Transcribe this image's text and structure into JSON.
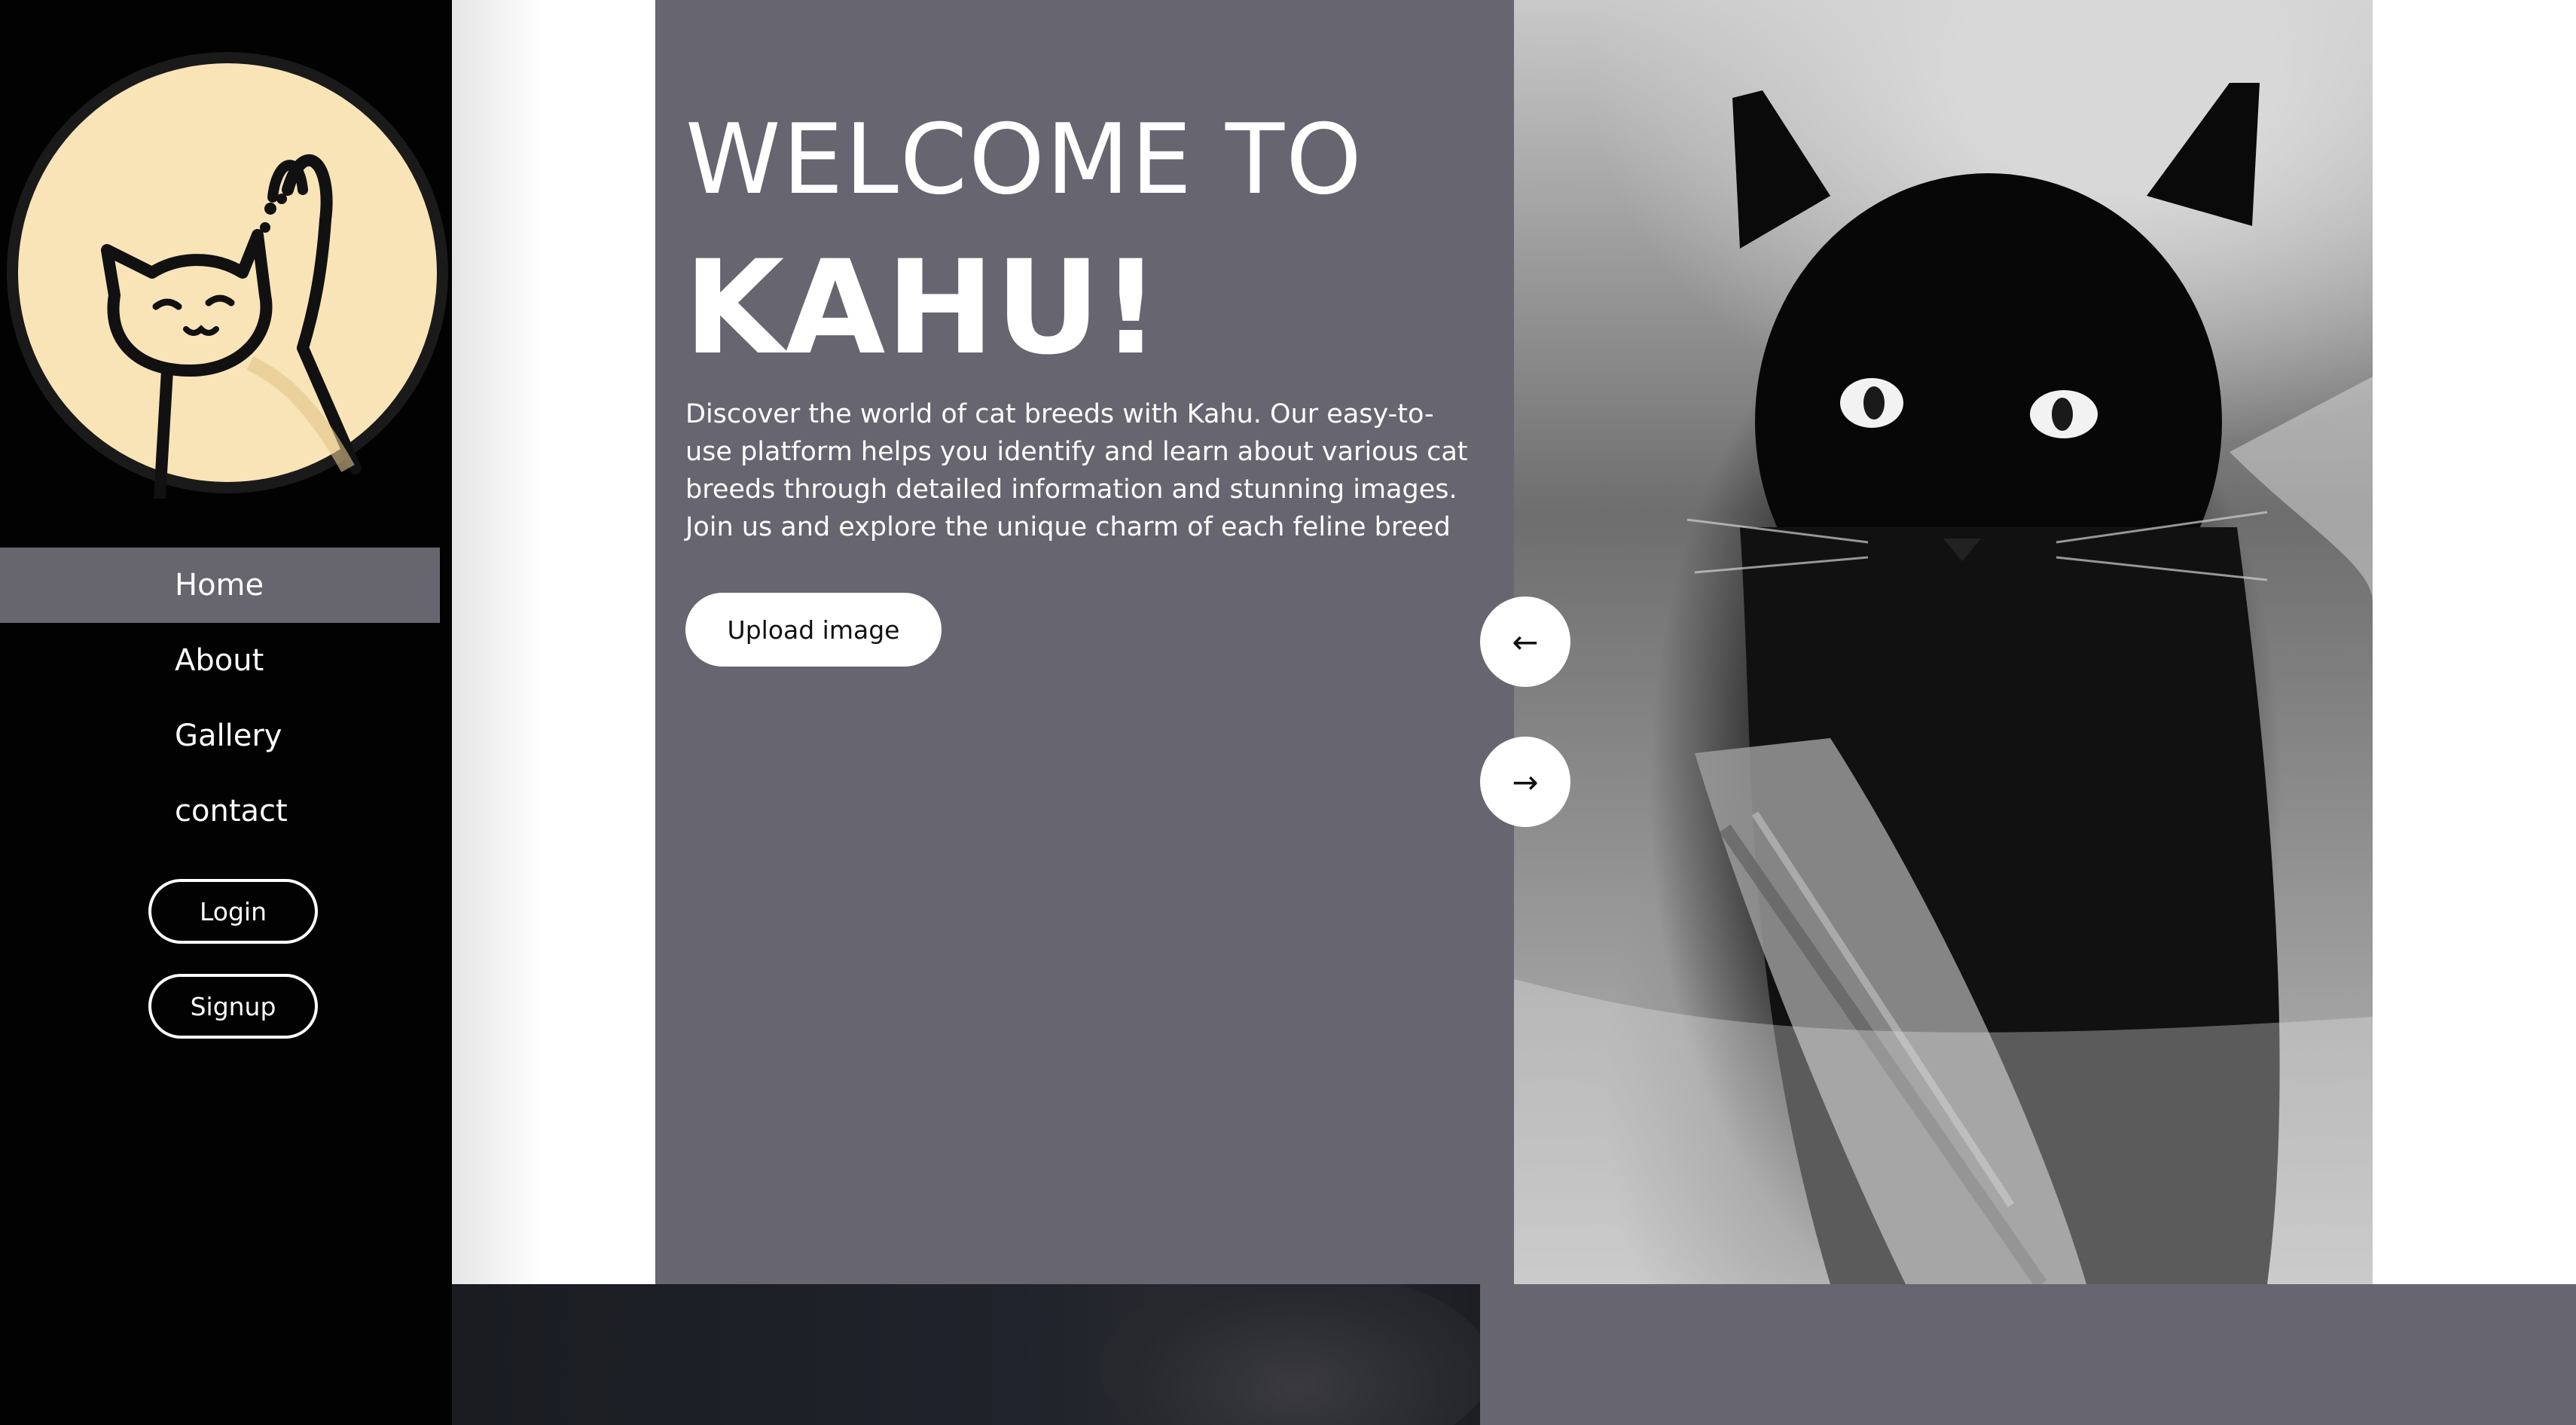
{
  "sidebar": {
    "nav": [
      {
        "label": "Home",
        "active": true
      },
      {
        "label": "About",
        "active": false
      },
      {
        "label": "Gallery",
        "active": false
      },
      {
        "label": "contact",
        "active": false
      }
    ],
    "login_label": "Login",
    "signup_label": "Signup",
    "logo_icon": "cat-waving-logo"
  },
  "hero": {
    "welcome": "WELCOME TO",
    "brand": "KAHU!",
    "description": "Discover the world of cat breeds with Kahu. Our easy-to-use platform helps you identify and learn about various cat breeds through detailed information and stunning images. Join us and explore the unique charm of each feline breed",
    "upload_label": "Upload image"
  },
  "carousel": {
    "prev_icon": "←",
    "next_icon": "→"
  },
  "colors": {
    "sidebar_bg": "#020203",
    "panel_bg": "#67656f",
    "active_nav_bg": "#67666f",
    "logo_bg": "#f9e4b7"
  }
}
